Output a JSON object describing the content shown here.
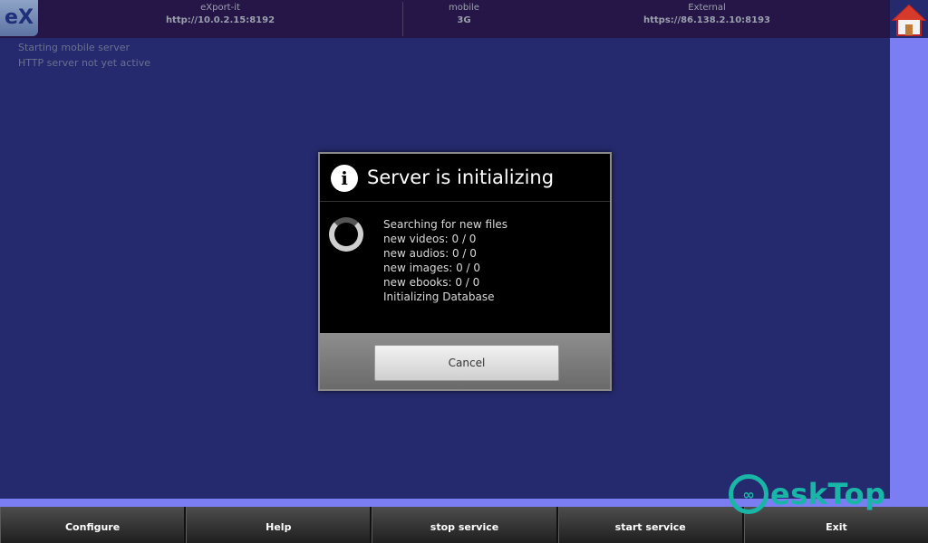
{
  "app": {
    "logo_text": "eX"
  },
  "topbar": {
    "col1_label": "eXport-it",
    "col1_value": "http://10.0.2.15:8192",
    "col2_label": "mobile",
    "col2_value": "3G",
    "col3_label": "External",
    "col3_value": "https://86.138.2.10:8193",
    "home_icon": "home-icon"
  },
  "status": {
    "line1": "Starting mobile server",
    "line2": "HTTP server not yet active"
  },
  "dialog": {
    "title": "Server is initializing",
    "icon": "info-icon",
    "lines": [
      "Searching for new files",
      "new videos: 0 / 0",
      "new audios: 0 / 0",
      "new images: 0 / 0",
      "new ebooks: 0 / 0",
      "Initializing Database"
    ],
    "cancel_label": "Cancel"
  },
  "bottombar": {
    "buttons": [
      "Configure",
      "Help",
      "stop service",
      "start service",
      "Exit"
    ]
  },
  "watermark": {
    "text": "esk op",
    "letters": "DT"
  },
  "colors": {
    "background": "#252a6e",
    "topbar": "#261547",
    "accent": "#7b7ef2",
    "watermark": "#19b6a8"
  }
}
